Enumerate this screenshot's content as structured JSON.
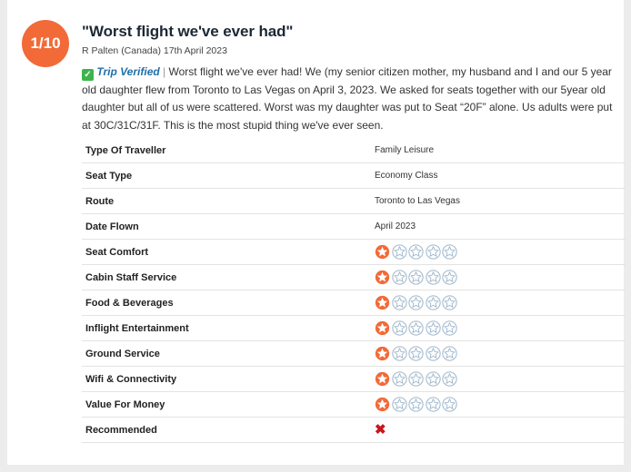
{
  "review": {
    "rating_badge": "1/10",
    "title": "\"Worst flight we've ever had\"",
    "byline": "R Palten (Canada) 17th April 2023",
    "verified_label": "Trip Verified",
    "separator": "|",
    "text": "Worst flight we've ever had! We (my senior citizen mother, my husband and I and our 5 year old daughter flew from Toronto to Las Vegas on April 3, 2023. We asked for seats together with our 5year old daughter but all of us were scattered. Worst was my daughter was put to Seat “20F” alone. Us adults were put at 30C/31C/31F. This is the most stupid thing we've ever seen."
  },
  "details": [
    {
      "label": "Type Of Traveller",
      "value": "Family Leisure"
    },
    {
      "label": "Seat Type",
      "value": "Economy Class"
    },
    {
      "label": "Route",
      "value": "Toronto to Las Vegas"
    },
    {
      "label": "Date Flown",
      "value": "April 2023"
    }
  ],
  "ratings": [
    {
      "label": "Seat Comfort",
      "stars": 1,
      "max": 5
    },
    {
      "label": "Cabin Staff Service",
      "stars": 1,
      "max": 5
    },
    {
      "label": "Food & Beverages",
      "stars": 1,
      "max": 5
    },
    {
      "label": "Inflight Entertainment",
      "stars": 1,
      "max": 5
    },
    {
      "label": "Ground Service",
      "stars": 1,
      "max": 5
    },
    {
      "label": "Wifi & Connectivity",
      "stars": 1,
      "max": 5
    },
    {
      "label": "Value For Money",
      "stars": 1,
      "max": 5
    }
  ],
  "recommended": {
    "label": "Recommended",
    "value": "no",
    "icon": "cross-icon"
  },
  "colors": {
    "badge": "#f26a38",
    "star_filled": "#f26a38",
    "star_empty_stroke": "#9fb7cc",
    "verified": "#3cb44b",
    "verified_text": "#1e6fa8",
    "not_recommended": "#c8161d"
  }
}
